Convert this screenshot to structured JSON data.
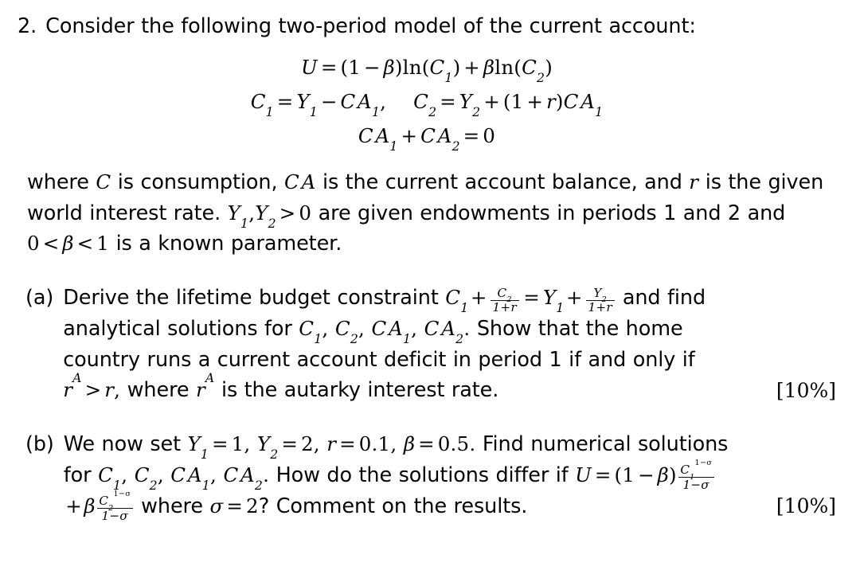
{
  "document": {
    "question_number": "2.",
    "intro": "Consider the following two-period model of the current account:",
    "equations": {
      "utility": {
        "lhs": "U",
        "eq": "=",
        "one": "(1",
        "minus": "−",
        "beta": "β",
        "close_ln1": ")ln(",
        "C1": "C",
        "sub1": "1",
        "paren_close1": ")",
        "plus": "+",
        "beta2": "β",
        "ln2": "ln(",
        "C2": "C",
        "sub2": "2",
        "paren_close2": ")",
        "full_text": "U = (1 − β)ln(C₁) + βln(C₂)"
      },
      "budget_period1": {
        "full_text": "C₁ = Y₁ − CA₁,"
      },
      "budget_period2": {
        "full_text": "C₂ = Y₂ + (1 + r)CA₁"
      },
      "ca_constraint": {
        "full_text": "CA₁ + CA₂ = 0"
      }
    },
    "where_paragraph": {
      "seg1": "where ",
      "var_C": "C",
      "seg2": " is consumption, ",
      "var_CA": "CA",
      "seg3": " is the current account balance, and ",
      "var_r": "r",
      "seg4": " is the given world interest rate. ",
      "var_Y1": "Y",
      "var_Y1_sub": "1",
      "comma": ",",
      "var_Y2": "Y",
      "var_Y2_sub": "2",
      "gt": ">",
      "zero": "0",
      "seg5": " are given endowments in periods 1 and 2 and ",
      "zero2": "0",
      "lt1": "<",
      "beta": "β",
      "lt2": "<",
      "one": "1",
      "seg6": " is a known parameter."
    },
    "parts": [
      {
        "label": "(a)",
        "marks": "[10%]",
        "text_seg1": "Derive the lifetime budget constraint ",
        "lbc": {
          "C1": "C",
          "C1_sub": "1",
          "plus": "+",
          "frac1_num_var": "C",
          "frac1_num_sub": "2",
          "frac1_den": "1+r",
          "equals": "=",
          "Y1": "Y",
          "Y1_sub": "1",
          "plus2": "+",
          "frac2_num_var": "Y",
          "frac2_num_sub": "2",
          "frac2_den": "1+r"
        },
        "text_seg2": " and find analytical solutions for ",
        "vars_list": "C₁, C₂, CA₁, CA₂.",
        "text_seg3": " Show that the home country runs a current account deficit in period 1 if and only if ",
        "autarky": {
          "r": "r",
          "sup_A": "A",
          "gt": ">",
          "r2": "r",
          "comma": ","
        },
        "text_seg4": " where ",
        "text_seg5": " is the autarky interest rate."
      },
      {
        "label": "(b)",
        "marks": "[10%]",
        "text_seg1": "We now set ",
        "params": {
          "Y1": "Y",
          "Y1_sub": "1",
          "eq1": "=",
          "val1": "1",
          "sep1": ",",
          "Y2": "Y",
          "Y2_sub": "2",
          "eq2": "=",
          "val2": "2",
          "sep2": ",",
          "r": "r",
          "eq3": "=",
          "val3": "0.1",
          "sep3": ",",
          "beta": "β",
          "eq4": "=",
          "val4": "0.5",
          "period": "."
        },
        "text_seg2": " Find numerical solutions for ",
        "vars_list": "C₁, C₂, CA₁, CA₂.",
        "text_seg3": " How do the solutions differ if ",
        "crra": {
          "U": "U",
          "eq": "=",
          "open": "(1",
          "minus": "−",
          "beta": "β",
          "close": ")",
          "C1": "C",
          "C1_sub": "1",
          "exp": "1−σ",
          "den": "1−σ",
          "plus": "+",
          "beta2": "β",
          "C2": "C",
          "C2_sub": "2"
        },
        "text_seg4": " where ",
        "sigma_def": {
          "sigma": "σ",
          "eq": "=",
          "val": "2"
        },
        "text_seg5": "? Comment on the results."
      }
    ]
  }
}
